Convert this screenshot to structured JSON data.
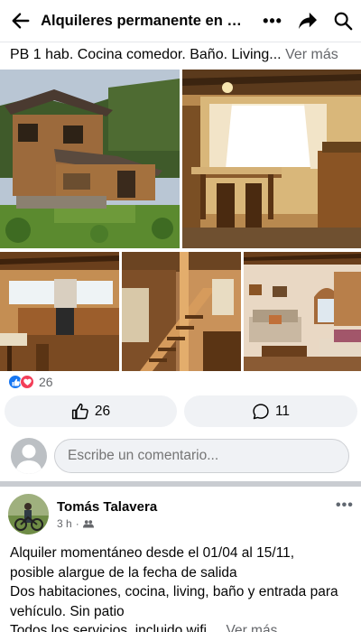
{
  "header": {
    "title": "Alquileres permanente en E...",
    "back_icon": "arrow-left-icon",
    "more_icon": "ellipsis-icon",
    "share_icon": "share-arrow-icon",
    "search_icon": "search-icon"
  },
  "post": {
    "text": "PB 1 hab. Cocina comedor. Baño. Living...",
    "see_more": "Ver más",
    "reactions": {
      "icons": [
        "like-icon",
        "love-icon"
      ],
      "count": "26"
    },
    "actions": {
      "like": {
        "icon": "thumbs-up-icon",
        "count": "26"
      },
      "comment": {
        "icon": "comment-bubble-icon",
        "count": "11"
      }
    }
  },
  "comment_box": {
    "placeholder": "Escribe un comentario..."
  },
  "post2": {
    "author": "Tomás Talavera",
    "time": "3 h",
    "privacy_icon": "group-icon",
    "lines": [
      "Alquiler momentáneo desde el 01/04 al 15/11,",
      "posible alargue de la fecha de salida",
      "Dos habitaciones, cocina, living, baño y entrada para",
      "vehículo. Sin patio",
      "Todos los servicios, incluido wifi ..."
    ],
    "see_more": "Ver más"
  },
  "colors": {
    "brand_blue": "#1877f2",
    "love_red": "#f33e58",
    "secondary_text": "#65676b",
    "pill_background": "#f0f2f5"
  }
}
